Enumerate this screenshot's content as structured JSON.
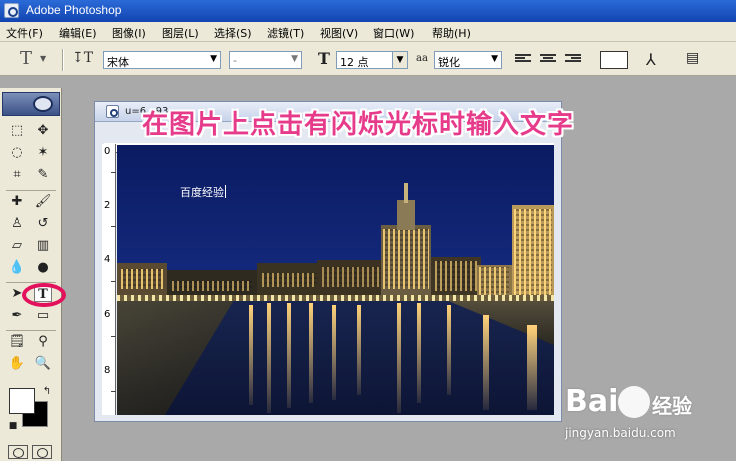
{
  "window": {
    "title": "Adobe Photoshop"
  },
  "menu": [
    {
      "label": "文件(F)"
    },
    {
      "label": "编辑(E)"
    },
    {
      "label": "图像(I)"
    },
    {
      "label": "图层(L)"
    },
    {
      "label": "选择(S)"
    },
    {
      "label": "滤镜(T)"
    },
    {
      "label": "视图(V)"
    },
    {
      "label": "窗口(W)"
    },
    {
      "label": "帮助(H)"
    }
  ],
  "options": {
    "font_family": "宋体",
    "font_style": "-",
    "font_size": "12 点",
    "antialias_label": "aa",
    "antialias": "锐化"
  },
  "document": {
    "title": "u=6...93"
  },
  "ruler": {
    "left_marks": [
      "0",
      "2",
      "4",
      "6",
      "8"
    ]
  },
  "canvas": {
    "typed_text": "百度经验"
  },
  "annotation": {
    "text": "在图片上点击有闪烁光标时输入文字"
  },
  "watermark": {
    "logo": "Bai",
    "brand": "经验",
    "url": "jingyan.baidu.com"
  },
  "colors": {
    "foreground": "#ffffff",
    "background": "#000000",
    "annotation": "#e63a8a",
    "highlight": "#e3105b"
  }
}
